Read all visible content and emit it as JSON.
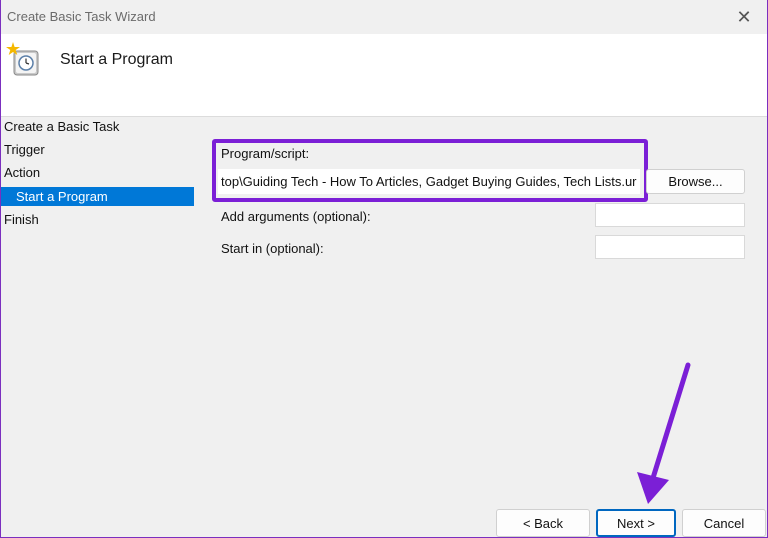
{
  "window": {
    "title": "Create Basic Task Wizard"
  },
  "header": {
    "title": "Start a Program",
    "icon": "task-clock-icon"
  },
  "steps": [
    {
      "label": "Create a Basic Task",
      "indent": false,
      "active": false
    },
    {
      "label": "Trigger",
      "indent": false,
      "active": false
    },
    {
      "label": "Action",
      "indent": false,
      "active": false
    },
    {
      "label": "Start a Program",
      "indent": true,
      "active": true
    },
    {
      "label": "Finish",
      "indent": false,
      "active": false
    }
  ],
  "form": {
    "program_label": "Program/script:",
    "program_value": "top\\Guiding Tech - How To Articles, Gadget Buying Guides, Tech Lists.url\"",
    "browse_label": "Browse...",
    "args_label": "Add arguments (optional):",
    "args_value": "",
    "startin_label": "Start in (optional):",
    "startin_value": ""
  },
  "buttons": {
    "back": "< Back",
    "next": "Next >",
    "cancel": "Cancel"
  },
  "colors": {
    "accent": "#0078d7",
    "highlight": "#7b1fd6"
  }
}
